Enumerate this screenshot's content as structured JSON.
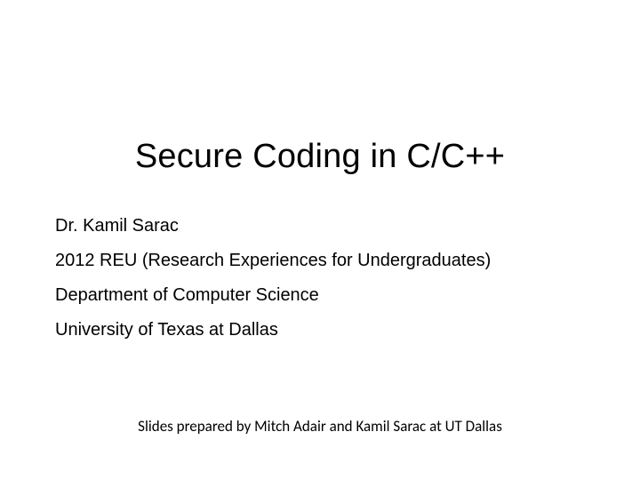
{
  "title": "Secure Coding in C/C++",
  "lines": {
    "l1": "Dr. Kamil Sarac",
    "l2": "2012 REU (Research Experiences for Undergraduates)",
    "l3": "Department of Computer Science",
    "l4": "University of Texas at Dallas"
  },
  "footer": "Slides prepared by Mitch Adair and Kamil Sarac at UT Dallas"
}
